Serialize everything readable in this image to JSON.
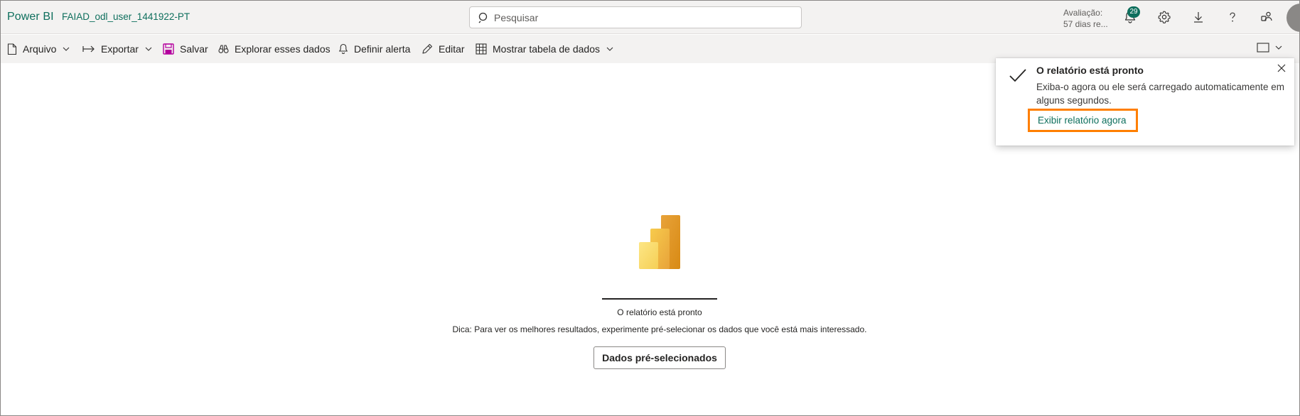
{
  "header": {
    "brand": "Power BI",
    "workspace": "FAIAD_odl_user_1441922-PT",
    "search_placeholder": "Pesquisar",
    "trial_line1": "Avaliação:",
    "trial_line2": "57 dias re...",
    "notification_count": "29"
  },
  "toolbar": {
    "file": "Arquivo",
    "export": "Exportar",
    "save": "Salvar",
    "explore": "Explorar esses dados",
    "alert": "Definir alerta",
    "edit": "Editar",
    "show_table": "Mostrar tabela de dados"
  },
  "main": {
    "status": "O relatório está pronto",
    "tip": "Dica: Para ver os melhores resultados, experimente pré-selecionar os dados que você está mais interessado.",
    "preselect_button": "Dados pré-selecionados"
  },
  "toast": {
    "title": "O relatório está pronto",
    "body": "Exiba-o agora ou ele será carregado automaticamente em alguns segundos.",
    "link": "Exibir relatório agora"
  },
  "colors": {
    "brand": "#0e6f5d",
    "highlight": "#ff7f00",
    "logo_light": "#f2c811",
    "logo_dark": "#e8a33a"
  }
}
